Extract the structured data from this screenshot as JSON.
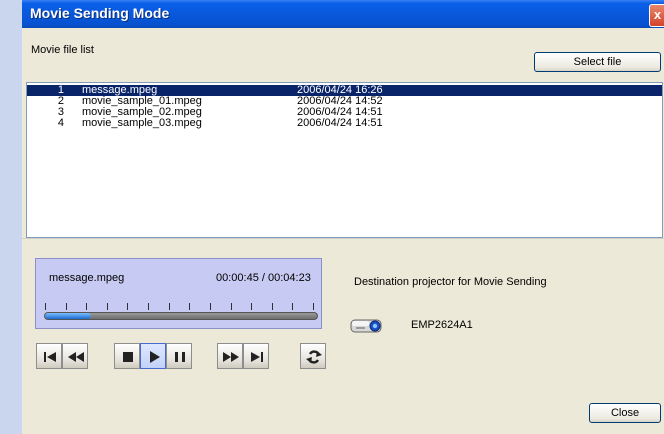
{
  "window": {
    "title": "Movie Sending Mode",
    "close_glyph": "x"
  },
  "file_list": {
    "label": "Movie file list",
    "select_button": "Select file",
    "rows": [
      {
        "num": "1",
        "name": "message.mpeg",
        "date": "2006/04/24 16:26",
        "selected": true
      },
      {
        "num": "2",
        "name": "movie_sample_01.mpeg",
        "date": "2006/04/24 14:52",
        "selected": false
      },
      {
        "num": "3",
        "name": "movie_sample_02.mpeg",
        "date": "2006/04/24 14:51",
        "selected": false
      },
      {
        "num": "4",
        "name": "movie_sample_03.mpeg",
        "date": "2006/04/24 14:51",
        "selected": false
      }
    ]
  },
  "player": {
    "current_file": "message.mpeg",
    "time": "00:00:45 / 00:04:23",
    "progress_percent": 17,
    "tick_count": 14,
    "controls": [
      {
        "name": "skip-to-start",
        "icon": "skip-back-icon",
        "active": false
      },
      {
        "name": "rewind",
        "icon": "rewind-icon",
        "active": false
      },
      {
        "name": "stop",
        "icon": "stop-icon",
        "active": false
      },
      {
        "name": "play",
        "icon": "play-icon",
        "active": true
      },
      {
        "name": "pause",
        "icon": "pause-icon",
        "active": false
      },
      {
        "name": "fast-forward",
        "icon": "fast-forward-icon",
        "active": false
      },
      {
        "name": "skip-to-end",
        "icon": "skip-forward-icon",
        "active": false
      },
      {
        "name": "repeat",
        "icon": "repeat-icon",
        "active": false
      }
    ]
  },
  "destination": {
    "label": "Destination projector for Movie Sending",
    "projector_name": "EMP2624A1",
    "projector_icon": "projector-icon"
  },
  "close_button": "Close",
  "colors": {
    "title_bar": "#0a58dc",
    "selection": "#0a246a",
    "player_bg": "#c7caf2",
    "progress": "#1c6cd0"
  }
}
